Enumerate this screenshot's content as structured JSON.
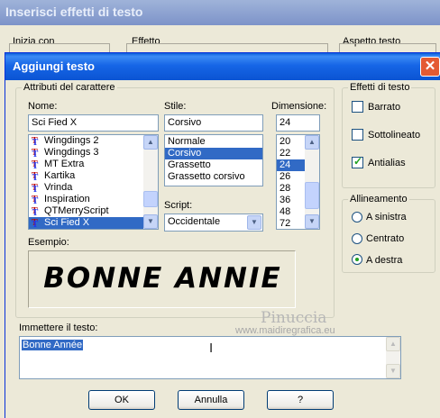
{
  "background_window": {
    "title": "Inserisci effetti di testo",
    "labels": [
      "Inizia con",
      "Effetto",
      "Aspetto testo"
    ]
  },
  "dialog": {
    "title": "Aggiungi testo",
    "close_glyph": "✕",
    "attributes_group": "Attributi del carattere",
    "name_label": "Nome:",
    "name_value": "Sci Fied X",
    "fonts": [
      {
        "label": "Wingdings 2",
        "selected": false
      },
      {
        "label": "Wingdings 3",
        "selected": false
      },
      {
        "label": "MT Extra",
        "selected": false
      },
      {
        "label": "Kartika",
        "selected": false
      },
      {
        "label": "Vrinda",
        "selected": false
      },
      {
        "label": "Inspiration",
        "selected": false
      },
      {
        "label": "QTMerryScript",
        "selected": false
      },
      {
        "label": "Sci Fied X",
        "selected": true
      }
    ],
    "style_label": "Stile:",
    "style_value": "Corsivo",
    "styles": [
      {
        "label": "Normale",
        "selected": false
      },
      {
        "label": "Corsivo",
        "selected": true
      },
      {
        "label": "Grassetto",
        "selected": false
      },
      {
        "label": "Grassetto corsivo",
        "selected": false
      }
    ],
    "size_label": "Dimensione:",
    "size_value": "24",
    "sizes": [
      {
        "label": "20",
        "selected": false
      },
      {
        "label": "22",
        "selected": false
      },
      {
        "label": "24",
        "selected": true
      },
      {
        "label": "26",
        "selected": false
      },
      {
        "label": "28",
        "selected": false
      },
      {
        "label": "36",
        "selected": false
      },
      {
        "label": "48",
        "selected": false
      },
      {
        "label": "72",
        "selected": false
      }
    ],
    "script_label": "Script:",
    "script_value": "Occidentale",
    "sample_label": "Esempio:",
    "sample_text": "BONNE ANNIE",
    "effects_group": "Effetti di testo",
    "effects": [
      {
        "label": "Barrato",
        "checked": false
      },
      {
        "label": "Sottolineato",
        "checked": false
      },
      {
        "label": "Antialias",
        "checked": true
      }
    ],
    "alignment_group": "Allineamento",
    "alignment": [
      {
        "label": "A sinistra",
        "selected": false
      },
      {
        "label": "Centrato",
        "selected": false
      },
      {
        "label": "A destra",
        "selected": true
      }
    ],
    "text_label": "Immettere il testo:",
    "text_value": "Bonne Année",
    "watermark_name": "Pinuccia",
    "watermark_url": "www.maidiregrafica.eu",
    "ok_label": "OK",
    "cancel_label": "Annulla",
    "help_label": "?"
  }
}
